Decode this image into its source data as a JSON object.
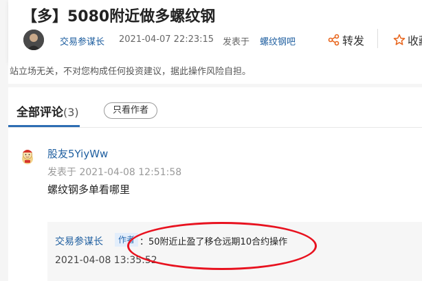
{
  "post": {
    "title": "【多】5080附近做多螺纹钢",
    "author": "交易参谋长",
    "time": "2021-04-07 22:23:15",
    "posted_in_label": "发表于",
    "board": "螺纹钢吧",
    "share_label": "转发",
    "collect_label": "收藏"
  },
  "disclaimer": "站立场无关，不对您构成任何投资建议，据此操作风险自担。",
  "comments": {
    "tab_label": "全部评论",
    "count": "(3)",
    "only_author_label": "只看作者",
    "items": [
      {
        "user": "股友5YiyWw",
        "time": "发表于 2021-04-08 12:51:58",
        "text": "螺纹钢多单看哪里",
        "reply": {
          "author": "交易参谋长",
          "tag": "作者",
          "text": "：50附近止盈了移仓远期10合约操作",
          "time": "2021-04-08 13:35:52"
        }
      }
    ]
  },
  "colors": {
    "link": "#1f5fa0",
    "accent": "#2d6db3",
    "share_icon": "#e8641b",
    "collect_icon": "#e8641b",
    "annotation": "#e8121f"
  },
  "icons": {
    "share": "share-icon",
    "collect": "star-icon"
  }
}
